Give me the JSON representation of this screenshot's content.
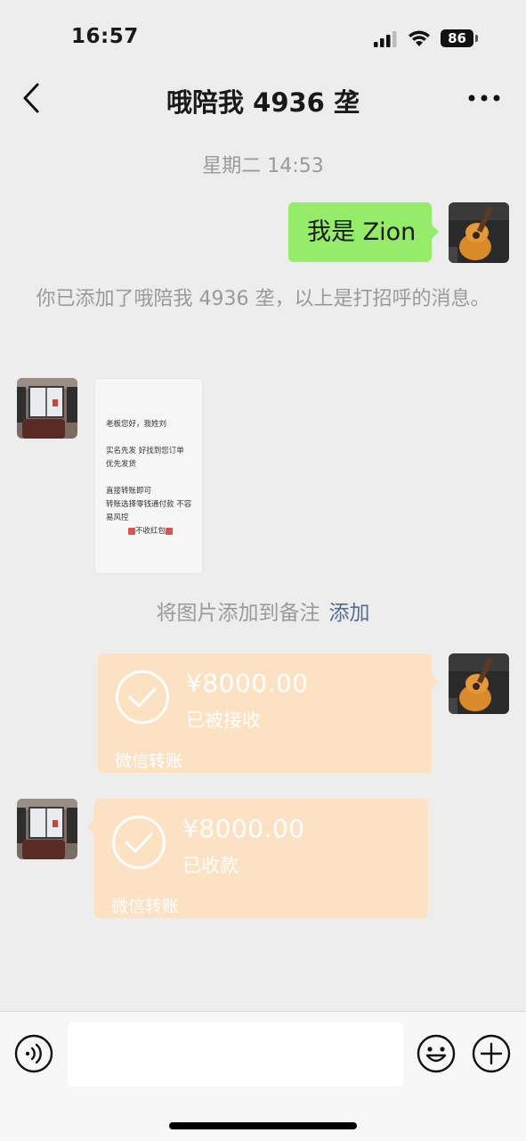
{
  "status_bar": {
    "time": "16:57",
    "battery": "86"
  },
  "nav": {
    "title": "哦陪我 4936 垄",
    "back_icon": "chevron-left-icon",
    "more_icon": "more-dots-icon"
  },
  "chat": {
    "time_label": "星期二 14:53",
    "my_message": "我是 Zion",
    "system_message": "你已添加了哦陪我 4936 垄，以上是打招呼的消息。",
    "image_message": {
      "lines": [
        "老板您好，我姓刘",
        "实名先发 好找到您订单",
        "优先发货",
        "直接转账即可",
        "转账选择零钱通付款 不容易风控",
        "不收红包"
      ]
    },
    "note_prompt": "将图片添加到备注",
    "note_action": "添加",
    "transfer_sent": {
      "amount": "¥8000.00",
      "status": "已被接收",
      "footer": "微信转账"
    },
    "transfer_received": {
      "amount": "¥8000.00",
      "status": "已收款",
      "footer": "微信转账"
    }
  },
  "input_bar": {
    "placeholder": ""
  },
  "colors": {
    "background": "#ededed",
    "my_bubble": "#95ec69",
    "transfer": "#fde1c3",
    "link": "#576b95"
  }
}
